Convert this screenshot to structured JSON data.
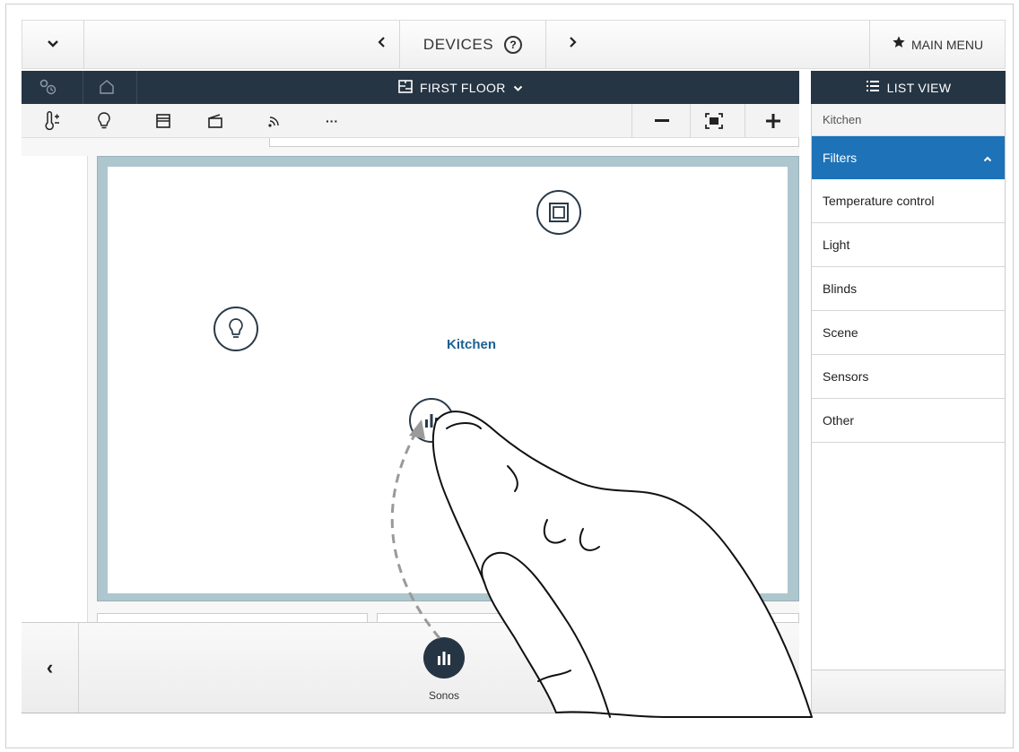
{
  "topbar": {
    "devices_title": "DEVICES",
    "help_symbol": "?",
    "main_menu_label": "MAIN MENU",
    "icons": [
      "chevron-down-icon",
      "chevron-left-icon",
      "help-icon",
      "chevron-right-icon",
      "star-icon"
    ]
  },
  "header": {
    "floor_label": "FIRST FLOOR",
    "list_view_label": "LIST VIEW"
  },
  "toolbar": {
    "tools": [
      "thermostat-icon",
      "lightbulb-icon",
      "blinds-icon",
      "scene-icon",
      "sensor-icon",
      "more-icon"
    ],
    "more_label": "···",
    "zoom_out": "−",
    "zoom_in": "+"
  },
  "canvas": {
    "room_label": "Kitchen",
    "devices": [
      "light-device-icon",
      "blinds-device-icon",
      "sonos-device-icon"
    ]
  },
  "tray": {
    "back_label": "‹",
    "device_label": "Sonos"
  },
  "right_panel": {
    "breadcrumb": "Kitchen",
    "filters_label": "Filters",
    "filters": [
      "Temperature control",
      "Light",
      "Blinds",
      "Scene",
      "Sensors",
      "Other"
    ]
  },
  "colors": {
    "dark_header": "#263544",
    "accent_blue": "#1e72b8",
    "room_label": "#1b5f94"
  }
}
